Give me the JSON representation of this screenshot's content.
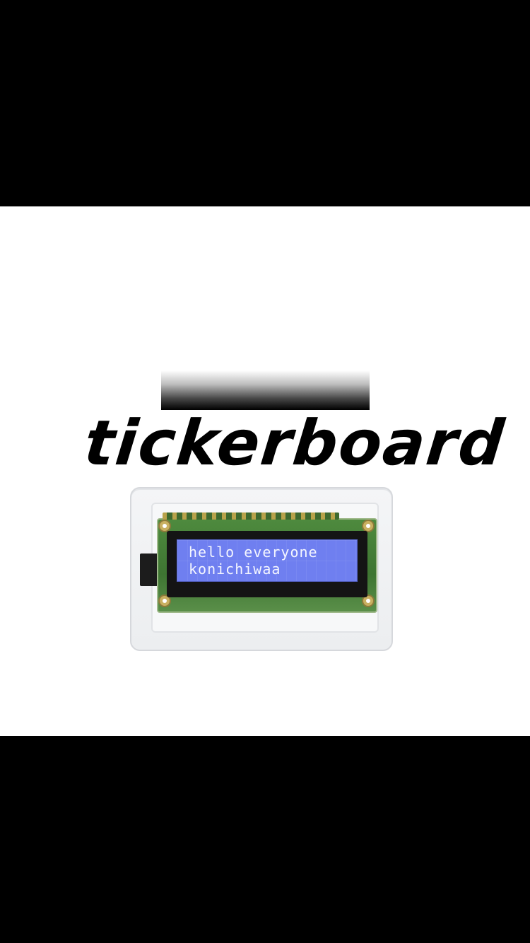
{
  "brand": {
    "wordmark": "tickerboard"
  },
  "device": {
    "lcd_line_1": "hello everyone",
    "lcd_line_2": "konichiwaa"
  },
  "colors": {
    "letterbox": "#000000",
    "background": "#ffffff",
    "lcd_backlight": "#6f7ff0",
    "pcb": "#4e8a3e"
  }
}
